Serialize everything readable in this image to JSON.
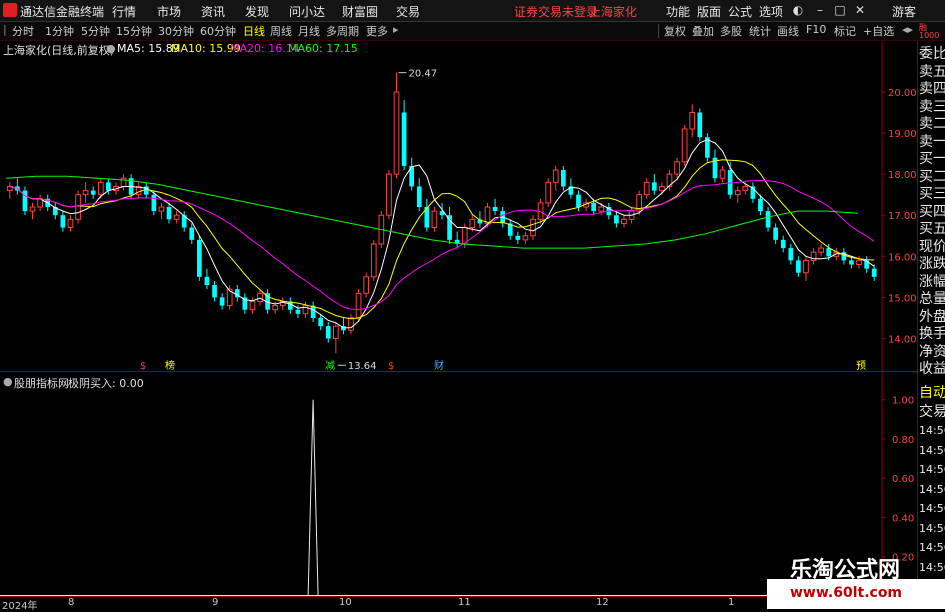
{
  "menubar": {
    "title": "通达信金融终端",
    "items": [
      "行情",
      "市场",
      "资讯",
      "发现",
      "问小达",
      "财富圈",
      "交易"
    ],
    "alert": "证券交易未登录",
    "stock": "上海家化",
    "right_items": [
      "功能",
      "版面",
      "公式",
      "选项"
    ],
    "guest": "游客"
  },
  "toolbar": {
    "periods": [
      "分时",
      "1分钟",
      "5分钟",
      "15分钟",
      "30分钟",
      "60分钟",
      "日线",
      "周线",
      "月线",
      "多周期",
      "更多"
    ],
    "active": "日线",
    "tools": [
      "复权",
      "叠加",
      "多股",
      "统计",
      "画线",
      "F10",
      "标记",
      "+自选"
    ]
  },
  "main_chart": {
    "title": "上海家化(日线,前复权)",
    "ma5": "MA5: 15.89",
    "ma10": "MA10: 15.99",
    "ma20": "MA20: 16.14",
    "ma60": "MA60: 17.15",
    "high_label": "20.47",
    "low_label": "13.64",
    "price_ticks": [
      "20.00",
      "19.00",
      "18.00",
      "17.00",
      "16.00",
      "15.00",
      "14.00"
    ],
    "price_range": [
      13.5,
      20.9
    ],
    "markers": [
      "$",
      "榜",
      "减",
      "$",
      "财",
      "预"
    ],
    "colors": {
      "ma5": "#ffffff",
      "ma10": "#ffff00",
      "ma20": "#ff00ff",
      "ma60": "#00ff00",
      "up": "#ff4040",
      "down": "#00ffff"
    }
  },
  "sub_chart": {
    "title": "股朋指标网",
    "label": "极阴买入: 0.00",
    "ticks": [
      "1.00",
      "0.80",
      "0.60",
      "0.40",
      "0.20"
    ]
  },
  "xaxis": [
    "2024年",
    "8",
    "9",
    "10",
    "11",
    "12",
    "1"
  ],
  "right_panel": {
    "items": [
      "委比",
      "卖五",
      "卖四",
      "卖三",
      "卖二",
      "卖一",
      "买一",
      "买二",
      "买三",
      "买四",
      "买五",
      "现价",
      "涨跌",
      "涨幅",
      "总量",
      "外盘",
      "换手",
      "净资",
      "收益"
    ],
    "header": "自动",
    "trade": "交易",
    "times": [
      "14:56",
      "14:56",
      "14:56",
      "14:56",
      "14:56",
      "14:56",
      "14:56",
      "14:56",
      "14:56"
    ]
  },
  "watermark": {
    "name": "乐淘公式网",
    "url": "www.60lt.com"
  },
  "chart_data": {
    "type": "candlestick",
    "candles": [
      [
        17.6,
        17.8,
        17.4,
        17.7
      ],
      [
        17.7,
        17.9,
        17.5,
        17.6
      ],
      [
        17.6,
        17.7,
        17.0,
        17.1
      ],
      [
        17.1,
        17.3,
        16.9,
        17.2
      ],
      [
        17.2,
        17.5,
        17.1,
        17.4
      ],
      [
        17.4,
        17.5,
        17.1,
        17.2
      ],
      [
        17.2,
        17.3,
        16.9,
        17.0
      ],
      [
        17.0,
        17.1,
        16.6,
        16.7
      ],
      [
        16.7,
        17.0,
        16.6,
        16.9
      ],
      [
        16.9,
        17.6,
        16.8,
        17.5
      ],
      [
        17.5,
        17.8,
        17.3,
        17.6
      ],
      [
        17.6,
        17.7,
        17.4,
        17.5
      ],
      [
        17.5,
        17.9,
        17.4,
        17.8
      ],
      [
        17.8,
        17.9,
        17.5,
        17.6
      ],
      [
        17.6,
        17.8,
        17.5,
        17.7
      ],
      [
        17.7,
        18.0,
        17.6,
        17.9
      ],
      [
        17.9,
        18.0,
        17.4,
        17.5
      ],
      [
        17.5,
        17.8,
        17.4,
        17.7
      ],
      [
        17.7,
        17.8,
        17.4,
        17.5
      ],
      [
        17.5,
        17.6,
        17.0,
        17.1
      ],
      [
        17.1,
        17.3,
        16.9,
        17.2
      ],
      [
        17.2,
        17.3,
        16.8,
        16.9
      ],
      [
        16.9,
        17.1,
        16.8,
        17.0
      ],
      [
        17.0,
        17.1,
        16.6,
        16.7
      ],
      [
        16.7,
        16.8,
        16.3,
        16.4
      ],
      [
        16.4,
        16.5,
        15.4,
        15.5
      ],
      [
        15.5,
        15.7,
        15.2,
        15.3
      ],
      [
        15.3,
        15.4,
        14.9,
        15.0
      ],
      [
        15.0,
        15.1,
        14.7,
        14.8
      ],
      [
        14.8,
        15.3,
        14.7,
        15.2
      ],
      [
        15.2,
        15.3,
        14.9,
        15.0
      ],
      [
        15.0,
        15.1,
        14.6,
        14.7
      ],
      [
        14.7,
        15.0,
        14.6,
        14.9
      ],
      [
        14.9,
        15.2,
        14.8,
        15.1
      ],
      [
        15.1,
        15.2,
        14.6,
        14.7
      ],
      [
        14.7,
        14.9,
        14.6,
        14.8
      ],
      [
        14.8,
        15.0,
        14.7,
        14.9
      ],
      [
        14.9,
        15.0,
        14.6,
        14.7
      ],
      [
        14.7,
        14.8,
        14.5,
        14.6
      ],
      [
        14.6,
        14.9,
        14.5,
        14.8
      ],
      [
        14.8,
        14.9,
        14.4,
        14.5
      ],
      [
        14.5,
        14.6,
        14.2,
        14.3
      ],
      [
        14.3,
        14.4,
        13.9,
        14.0
      ],
      [
        14.0,
        14.4,
        13.64,
        14.3
      ],
      [
        14.3,
        14.5,
        14.1,
        14.2
      ],
      [
        14.2,
        14.6,
        14.1,
        14.5
      ],
      [
        14.5,
        15.2,
        14.4,
        15.1
      ],
      [
        15.1,
        15.6,
        15.0,
        15.5
      ],
      [
        15.5,
        16.4,
        15.4,
        16.3
      ],
      [
        16.3,
        17.1,
        16.2,
        17.0
      ],
      [
        17.0,
        18.1,
        16.9,
        18.0
      ],
      [
        18.0,
        20.47,
        17.9,
        20.0
      ],
      [
        19.5,
        19.8,
        18.1,
        18.2
      ],
      [
        18.2,
        18.4,
        17.6,
        17.7
      ],
      [
        17.7,
        17.9,
        17.1,
        17.2
      ],
      [
        17.2,
        17.4,
        16.6,
        16.7
      ],
      [
        16.7,
        17.2,
        16.6,
        17.1
      ],
      [
        17.1,
        17.3,
        16.9,
        17.0
      ],
      [
        17.0,
        17.2,
        16.3,
        16.4
      ],
      [
        16.4,
        16.6,
        16.2,
        16.3
      ],
      [
        16.3,
        16.8,
        16.2,
        16.7
      ],
      [
        16.7,
        17.0,
        16.6,
        16.9
      ],
      [
        16.9,
        17.1,
        16.7,
        16.8
      ],
      [
        16.8,
        17.3,
        16.7,
        17.2
      ],
      [
        17.2,
        17.4,
        17.0,
        17.1
      ],
      [
        17.1,
        17.2,
        16.7,
        16.8
      ],
      [
        16.8,
        16.9,
        16.4,
        16.5
      ],
      [
        16.5,
        16.6,
        16.3,
        16.4
      ],
      [
        16.4,
        16.6,
        16.3,
        16.5
      ],
      [
        16.5,
        17.0,
        16.4,
        16.9
      ],
      [
        16.9,
        17.4,
        16.8,
        17.3
      ],
      [
        17.3,
        17.9,
        17.2,
        17.8
      ],
      [
        17.8,
        18.2,
        17.6,
        18.1
      ],
      [
        18.1,
        18.2,
        17.6,
        17.7
      ],
      [
        17.7,
        17.9,
        17.4,
        17.5
      ],
      [
        17.5,
        17.6,
        17.1,
        17.2
      ],
      [
        17.2,
        17.4,
        17.1,
        17.3
      ],
      [
        17.3,
        17.4,
        17.0,
        17.1
      ],
      [
        17.1,
        17.3,
        17.0,
        17.2
      ],
      [
        17.2,
        17.3,
        16.9,
        17.0
      ],
      [
        17.0,
        17.1,
        16.7,
        16.8
      ],
      [
        16.8,
        17.0,
        16.7,
        16.9
      ],
      [
        16.9,
        17.2,
        16.8,
        17.1
      ],
      [
        17.1,
        17.6,
        17.0,
        17.5
      ],
      [
        17.5,
        17.9,
        17.4,
        17.8
      ],
      [
        17.8,
        18.0,
        17.5,
        17.6
      ],
      [
        17.6,
        17.8,
        17.5,
        17.7
      ],
      [
        17.7,
        18.1,
        17.6,
        18.0
      ],
      [
        18.0,
        18.4,
        17.9,
        18.3
      ],
      [
        18.3,
        19.2,
        18.2,
        19.1
      ],
      [
        19.1,
        19.7,
        18.9,
        19.5
      ],
      [
        19.5,
        19.6,
        18.8,
        18.9
      ],
      [
        18.9,
        19.0,
        18.3,
        18.4
      ],
      [
        18.4,
        18.6,
        17.8,
        17.9
      ],
      [
        17.9,
        18.2,
        17.8,
        18.1
      ],
      [
        18.1,
        18.3,
        17.4,
        17.5
      ],
      [
        17.5,
        17.7,
        17.3,
        17.6
      ],
      [
        17.6,
        17.8,
        17.5,
        17.7
      ],
      [
        17.7,
        17.8,
        17.3,
        17.4
      ],
      [
        17.4,
        17.5,
        17.0,
        17.1
      ],
      [
        17.1,
        17.2,
        16.6,
        16.7
      ],
      [
        16.7,
        16.8,
        16.3,
        16.4
      ],
      [
        16.4,
        16.5,
        16.1,
        16.2
      ],
      [
        16.2,
        16.3,
        15.8,
        15.9
      ],
      [
        15.9,
        16.0,
        15.5,
        15.6
      ],
      [
        15.6,
        16.0,
        15.4,
        15.9
      ],
      [
        15.9,
        16.2,
        15.8,
        16.1
      ],
      [
        16.1,
        16.3,
        16.0,
        16.2
      ],
      [
        16.2,
        16.3,
        15.9,
        16.0
      ],
      [
        16.0,
        16.2,
        15.9,
        16.1
      ],
      [
        16.1,
        16.2,
        15.8,
        15.9
      ],
      [
        15.9,
        16.0,
        15.7,
        15.8
      ],
      [
        15.8,
        16.0,
        15.7,
        15.9
      ],
      [
        15.9,
        16.0,
        15.6,
        15.7
      ],
      [
        15.7,
        15.8,
        15.4,
        15.5
      ]
    ],
    "ma60_points": [
      17.9,
      17.95,
      17.95,
      17.9,
      17.85,
      17.75,
      17.6,
      17.45,
      17.3,
      17.15,
      17.0,
      16.85,
      16.7,
      16.55,
      16.4,
      16.3,
      16.25,
      16.2,
      16.2,
      16.2,
      16.25,
      16.3,
      16.4,
      16.55,
      16.75,
      16.95,
      17.1,
      17.1,
      17.05
    ],
    "indicator": {
      "peak_index": 40,
      "peak_value": 1.0,
      "ylim": [
        0,
        1.08
      ]
    }
  }
}
